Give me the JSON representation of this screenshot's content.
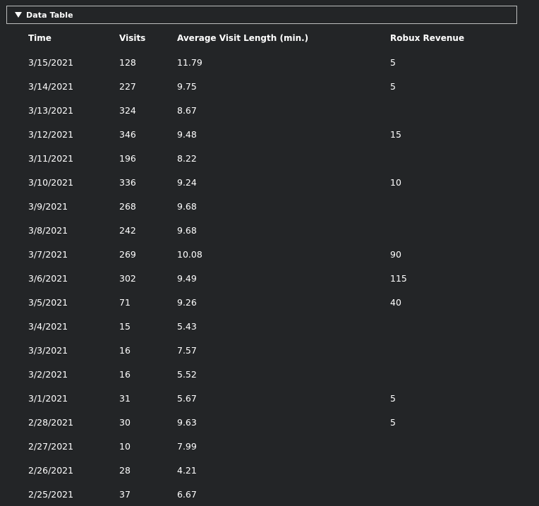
{
  "panel": {
    "title": "Data Table",
    "expanded": true
  },
  "table": {
    "headers": [
      "Time",
      "Visits",
      "Average Visit Length (min.)",
      "Robux Revenue"
    ],
    "rows": [
      [
        "3/15/2021",
        "128",
        "11.79",
        "5"
      ],
      [
        "3/14/2021",
        "227",
        "9.75",
        "5"
      ],
      [
        "3/13/2021",
        "324",
        "8.67",
        ""
      ],
      [
        "3/12/2021",
        "346",
        "9.48",
        "15"
      ],
      [
        "3/11/2021",
        "196",
        "8.22",
        ""
      ],
      [
        "3/10/2021",
        "336",
        "9.24",
        "10"
      ],
      [
        "3/9/2021",
        "268",
        "9.68",
        ""
      ],
      [
        "3/8/2021",
        "242",
        "9.68",
        ""
      ],
      [
        "3/7/2021",
        "269",
        "10.08",
        "90"
      ],
      [
        "3/6/2021",
        "302",
        "9.49",
        "115"
      ],
      [
        "3/5/2021",
        "71",
        "9.26",
        "40"
      ],
      [
        "3/4/2021",
        "15",
        "5.43",
        ""
      ],
      [
        "3/3/2021",
        "16",
        "7.57",
        ""
      ],
      [
        "3/2/2021",
        "16",
        "5.52",
        ""
      ],
      [
        "3/1/2021",
        "31",
        "5.67",
        "5"
      ],
      [
        "2/28/2021",
        "30",
        "9.63",
        "5"
      ],
      [
        "2/27/2021",
        "10",
        "7.99",
        ""
      ],
      [
        "2/26/2021",
        "28",
        "4.21",
        ""
      ],
      [
        "2/25/2021",
        "37",
        "6.67",
        ""
      ]
    ]
  },
  "colors": {
    "background": "#232527",
    "text": "#ffffff",
    "border": "#bdbebe"
  }
}
